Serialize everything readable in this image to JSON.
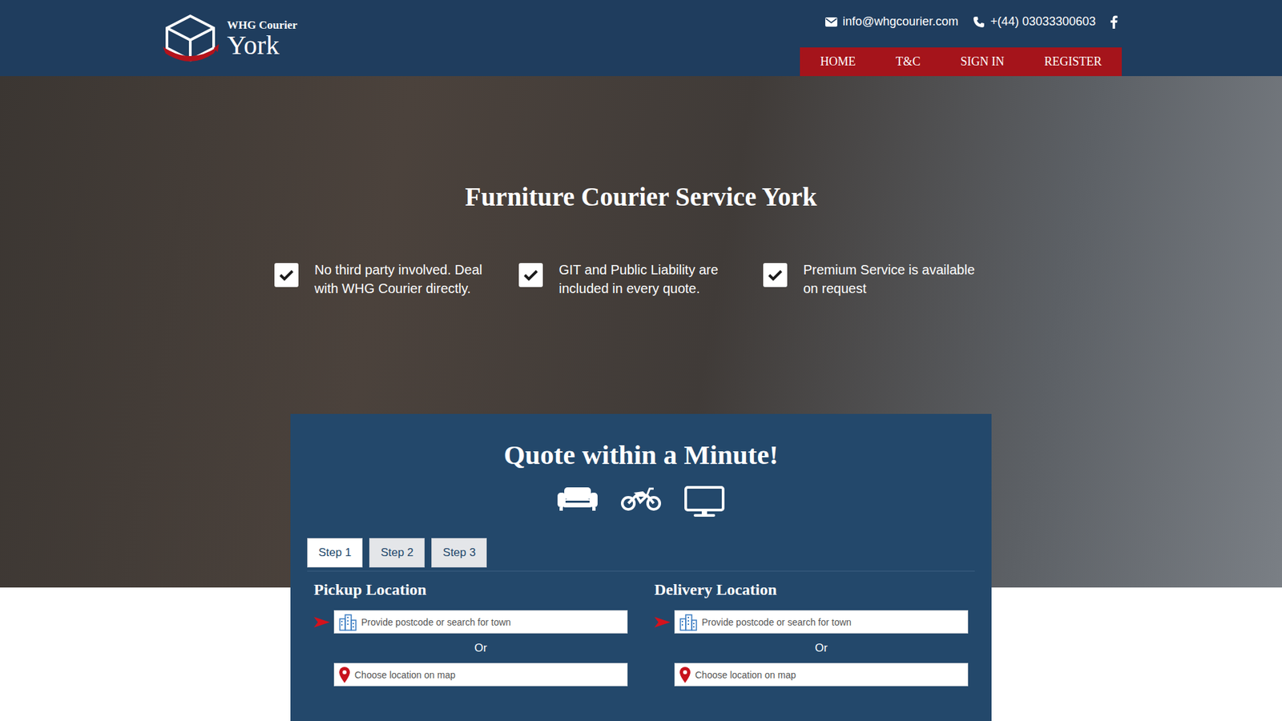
{
  "logo": {
    "small": "WHG Courier",
    "large": "York"
  },
  "contact": {
    "email": "info@whgcourier.com",
    "phone": "+(44) 03033300603"
  },
  "nav": [
    {
      "label": "HOME"
    },
    {
      "label": "T&C"
    },
    {
      "label": "SIGN IN"
    },
    {
      "label": "REGISTER"
    }
  ],
  "hero": {
    "title": "Furniture Courier Service York",
    "features": [
      {
        "text": "No third party involved. Deal with WHG Courier directly.",
        "checked": true
      },
      {
        "text": "GIT and Public Liability are included in every quote.",
        "checked": true
      },
      {
        "text": "Premium Service is available on request",
        "checked": true
      }
    ]
  },
  "quote": {
    "title": "Quote within a Minute!",
    "steps": [
      {
        "label": "Step 1",
        "selected": true
      },
      {
        "label": "Step 2",
        "selected": false
      },
      {
        "label": "Step 3",
        "selected": false
      }
    ],
    "locations": [
      {
        "heading": "Pickup Location",
        "search_placeholder": "Provide postcode or search for town",
        "or": "Or",
        "map_placeholder": "Choose location on map"
      },
      {
        "heading": "Delivery Location",
        "search_placeholder": "Provide postcode or search for town",
        "or": "Or",
        "map_placeholder": "Choose location on map"
      }
    ]
  }
}
